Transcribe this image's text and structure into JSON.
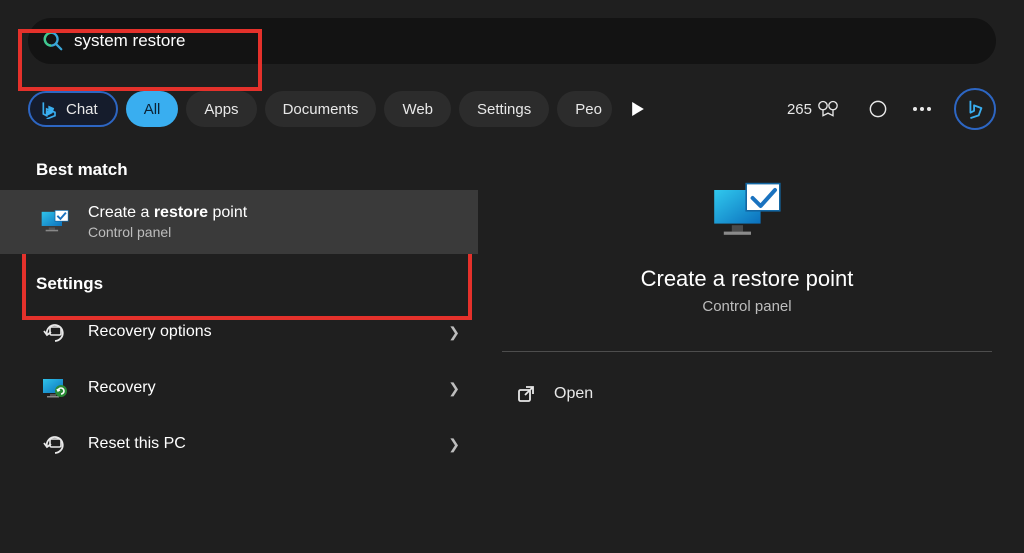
{
  "search": {
    "query": "system restore"
  },
  "filters": {
    "chat": "Chat",
    "all": "All",
    "apps": "Apps",
    "documents": "Documents",
    "web": "Web",
    "settings": "Settings",
    "people": "Peo"
  },
  "toolbar": {
    "points": "265"
  },
  "sections": {
    "best_match": "Best match",
    "settings": "Settings"
  },
  "best_match": {
    "title_prefix": "Create a ",
    "title_bold": "restore",
    "title_suffix": " point",
    "subtitle": "Control panel"
  },
  "settings_items": [
    {
      "label": "Recovery options"
    },
    {
      "label": "Recovery"
    },
    {
      "label": "Reset this PC"
    }
  ],
  "detail": {
    "title": "Create a restore point",
    "subtitle": "Control panel",
    "open": "Open"
  }
}
